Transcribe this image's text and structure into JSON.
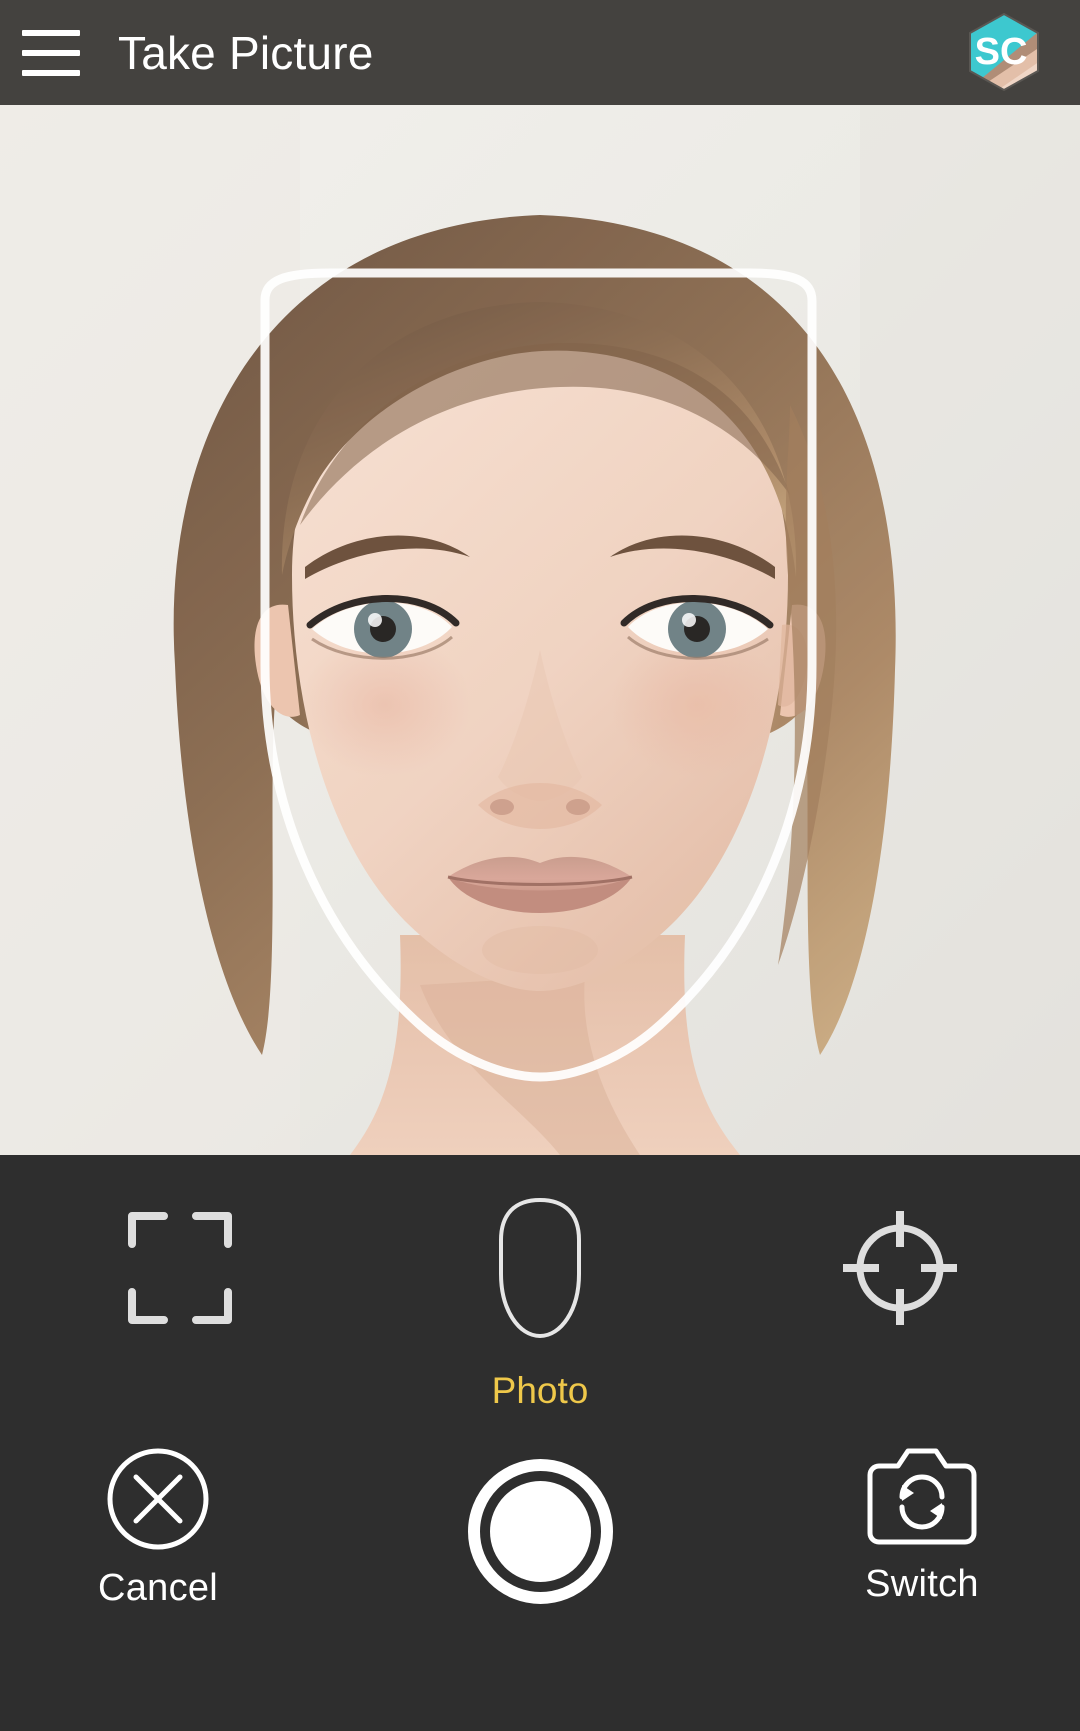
{
  "app": {
    "background_color": "#2e2e2e",
    "header_color": "#44423f",
    "accent_color": "#efc84a"
  },
  "header": {
    "menu_icon": "hamburger-menu-icon",
    "title": "Take Picture",
    "logo": {
      "icon": "app-logo-hexagon-icon",
      "text": "SC",
      "teal_color": "#3dc8cf",
      "band_color": "#b08d77"
    }
  },
  "viewfinder": {
    "subject": "portrait photo of a woman facing the camera",
    "guide_overlay": "face-outline-guide",
    "guide_color": "#ffffff"
  },
  "modes": [
    {
      "id": "crop-frame",
      "icon": "crop-corners-icon",
      "selected": false
    },
    {
      "id": "face-oval",
      "icon": "face-oval-icon",
      "selected": false
    },
    {
      "id": "target",
      "icon": "crosshair-target-icon",
      "selected": false
    }
  ],
  "mode_label": "Photo",
  "actions": {
    "cancel": {
      "label": "Cancel",
      "icon": "cancel-circle-x-icon"
    },
    "shutter": {
      "label": "",
      "icon": "shutter-button-icon"
    },
    "switch": {
      "label": "Switch",
      "icon": "camera-switch-icon"
    }
  }
}
